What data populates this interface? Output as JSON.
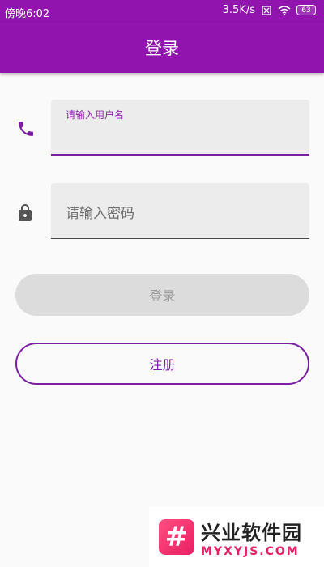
{
  "status_bar": {
    "time": "傍晚6:02",
    "network_speed": "3.5K/s",
    "battery_level": "63",
    "icons": [
      "sim-off-icon",
      "wifi-icon",
      "battery-icon"
    ]
  },
  "app_bar": {
    "title": "登录"
  },
  "form": {
    "username": {
      "label": "请输入用户名",
      "value": "",
      "icon": "phone-icon",
      "accent_color": "#7b1fa2"
    },
    "password": {
      "placeholder": "请输入密码",
      "value": "",
      "icon": "lock-icon"
    }
  },
  "buttons": {
    "login_label": "登录",
    "register_label": "注册"
  },
  "watermark": {
    "name": "兴业软件园",
    "url": "MYXYJS.COM",
    "logo_glyph": "#"
  },
  "colors": {
    "primary": "#9014ad",
    "accent": "#7b1fa2",
    "disabled_button": "#dcdcdc",
    "field_background": "#ececec"
  }
}
